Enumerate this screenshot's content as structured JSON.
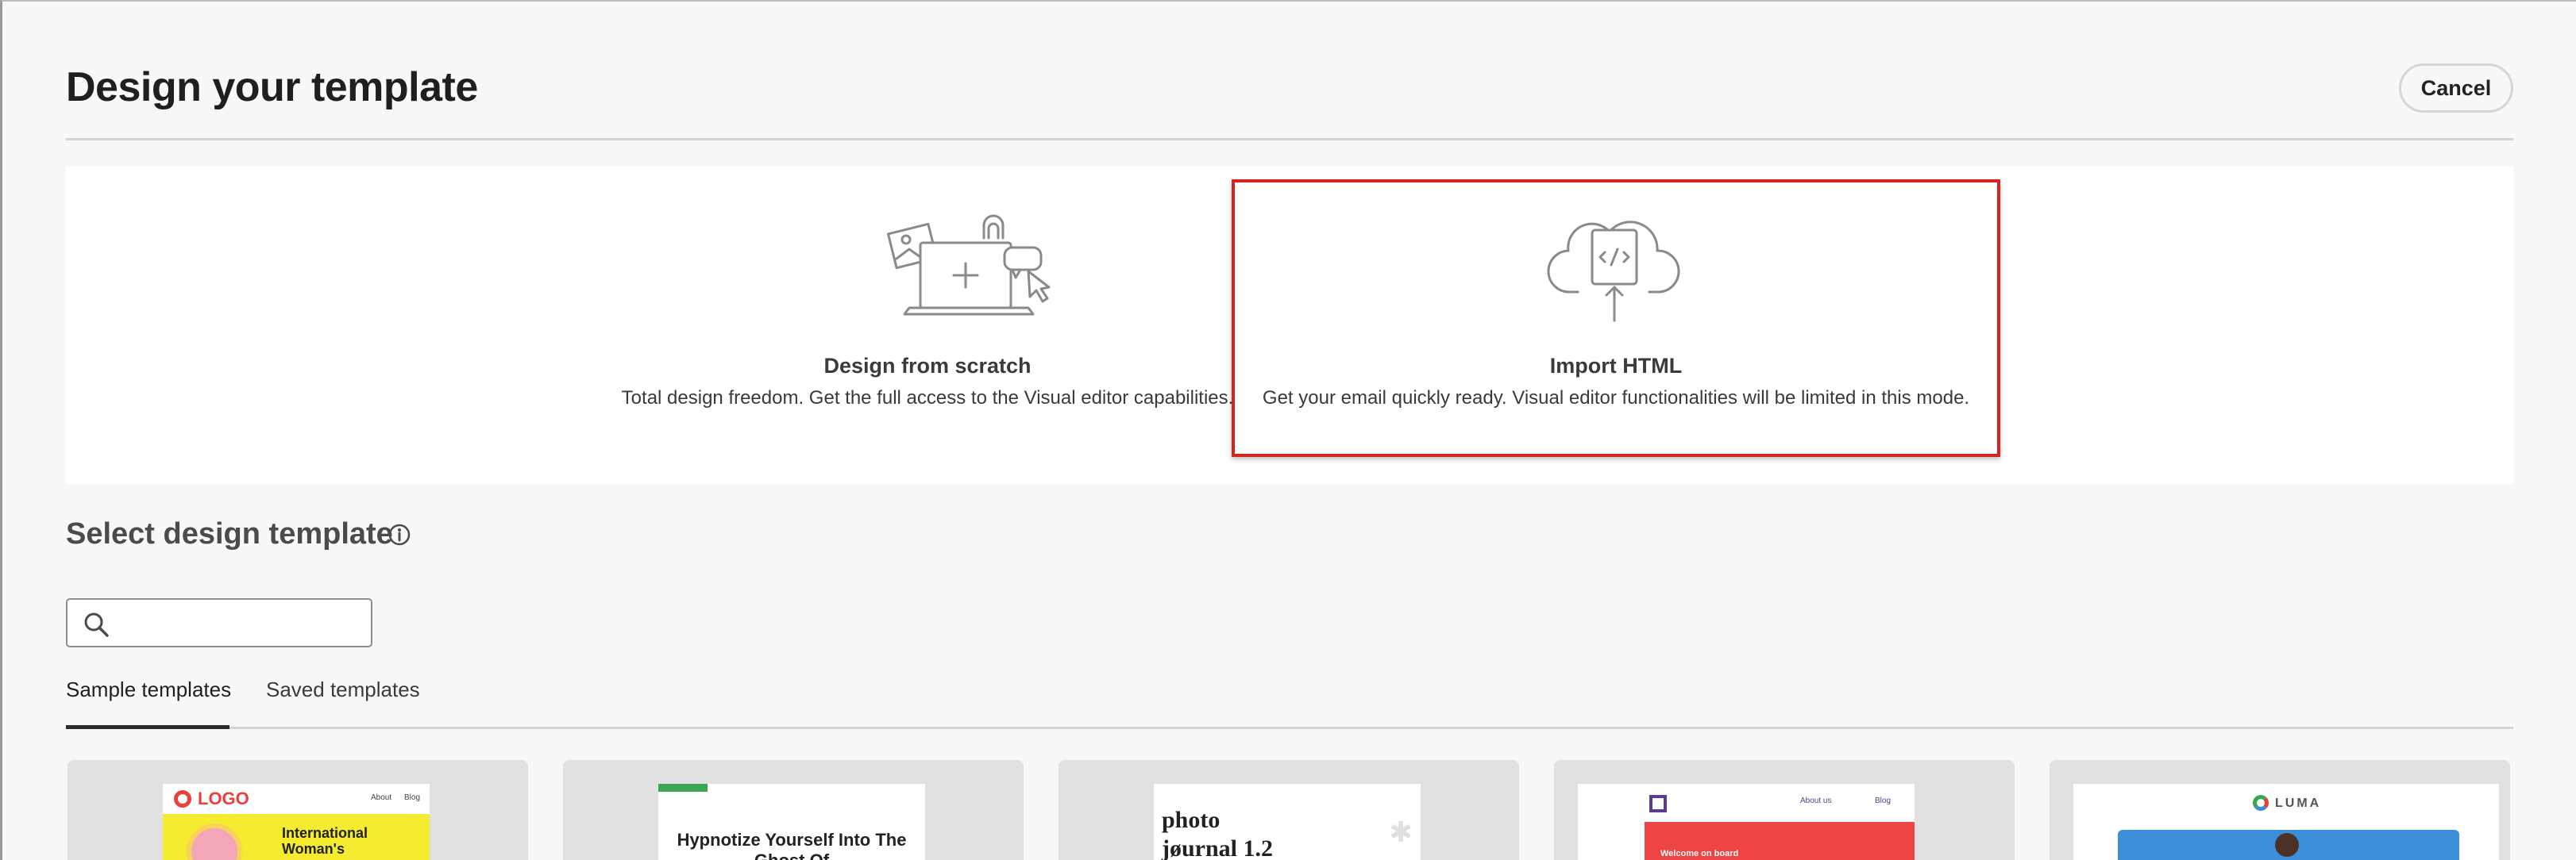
{
  "header": {
    "title": "Design your template",
    "cancel_label": "Cancel"
  },
  "start_options": [
    {
      "icon": "laptop-plus-icon",
      "title": "Design from scratch",
      "description": "Total design freedom. Get the full access to the Visual editor capabilities."
    },
    {
      "icon": "cloud-upload-code-icon",
      "title": "Import HTML",
      "description": "Get your email quickly ready. Visual editor functionalities will be limited in this mode.",
      "highlighted": true
    }
  ],
  "templates_section": {
    "title": "Select design template",
    "info_icon": "info-icon",
    "search": {
      "value": "",
      "placeholder": ""
    },
    "tabs": [
      {
        "label": "Sample templates",
        "active": true
      },
      {
        "label": "Saved templates",
        "active": false
      }
    ],
    "cards": [
      {
        "name": "International Woman's Day",
        "logo_text": "LOGO",
        "nav": [
          "About",
          "Blog"
        ],
        "headline": "International Woman's"
      },
      {
        "name": "Hypnotize",
        "headline": "Hypnotize Yourself Into The Ghost Of"
      },
      {
        "name": "Photo journal",
        "headline": "photo jøurnal 1.2"
      },
      {
        "name": "Welcome on board",
        "nav": [
          "About us",
          "Blog"
        ],
        "headline": "Welcome on board"
      },
      {
        "name": "Luma",
        "logo_text": "LUMA"
      }
    ]
  },
  "colors": {
    "highlight_border": "#d3261f",
    "card_yellow": "#f5ec2f",
    "card_red": "#ef4444",
    "card_blue": "#3b8fd9",
    "accent_green": "#3aa655"
  }
}
